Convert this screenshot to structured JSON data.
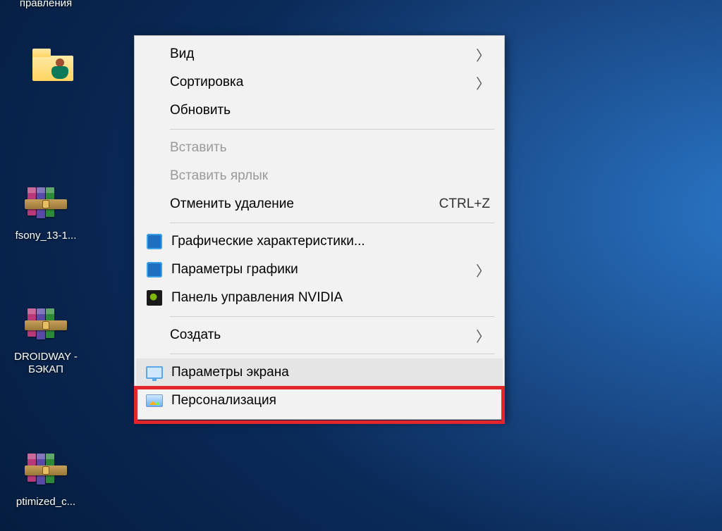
{
  "desktop": {
    "control_panel_label_fragment": "правления",
    "icons": [
      {
        "label": ""
      },
      {
        "label": "fsony_13-1..."
      },
      {
        "label": "DROIDWAY - БЭКАП"
      },
      {
        "label": "ptimized_c..."
      }
    ]
  },
  "context_menu": {
    "view": {
      "label": "Вид"
    },
    "sort": {
      "label": "Сортировка"
    },
    "refresh": {
      "label": "Обновить"
    },
    "paste": {
      "label": "Вставить"
    },
    "paste_shortcut": {
      "label": "Вставить ярлык"
    },
    "undo_delete": {
      "label": "Отменить удаление",
      "shortcut": "CTRL+Z"
    },
    "gfx_props": {
      "label": "Графические характеристики..."
    },
    "gfx_params": {
      "label": "Параметры графики"
    },
    "nvidia": {
      "label": "Панель управления NVIDIA"
    },
    "new": {
      "label": "Создать"
    },
    "display_settings": {
      "label": "Параметры экрана"
    },
    "personalize": {
      "label": "Персонализация"
    }
  }
}
